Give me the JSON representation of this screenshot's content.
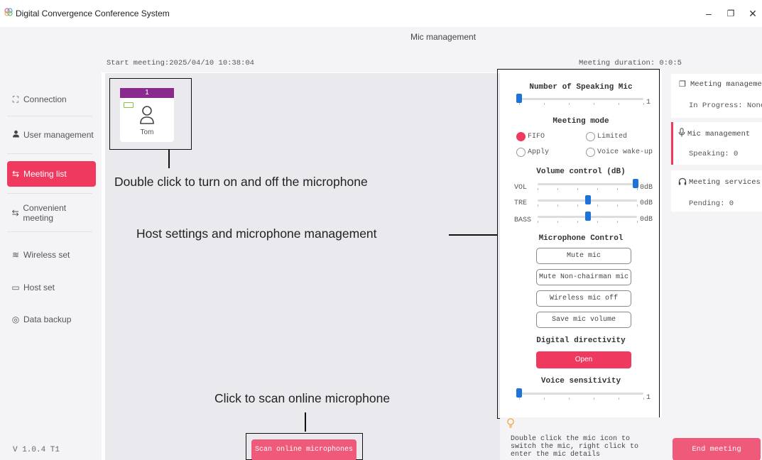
{
  "window": {
    "title": "Digital Convergence Conference System",
    "minimize_label": "–",
    "restore_label": "❐",
    "close_label": "✕"
  },
  "sidebar": {
    "items": [
      {
        "label": "Connection",
        "icon": "connection-icon",
        "glyph": "⛶"
      },
      {
        "label": "User management",
        "icon": "user-icon",
        "glyph": "👤"
      },
      {
        "label": "Meeting list",
        "icon": "swap-icon",
        "glyph": "⇆",
        "active": true
      },
      {
        "label": "Convenient meeting",
        "icon": "swap-icon",
        "glyph": "⇆"
      },
      {
        "label": "Wireless set",
        "icon": "wifi-icon",
        "glyph": "≋"
      },
      {
        "label": "Host set",
        "icon": "host-icon",
        "glyph": "▭"
      },
      {
        "label": "Data backup",
        "icon": "backup-icon",
        "glyph": "◎"
      }
    ],
    "version": "V 1.0.4 T1"
  },
  "main": {
    "title": "Mic management",
    "start_meeting": "Start meeting:2025/04/10 10:38:04",
    "meeting_duration": "Meeting duration: 0:0:5",
    "mic": {
      "number": "1",
      "name": "Tom"
    },
    "scan_button": "Scan online microphones"
  },
  "annotations": {
    "double_click": "Double click to turn on and off the microphone",
    "host_settings": "Host settings and microphone management",
    "scan": "Click to scan online microphone"
  },
  "settings": {
    "speaking_mic_title": "Number of Speaking Mic",
    "speaking_mic_value": "1",
    "speaking_mic_level": 0,
    "meeting_mode_title": "Meeting mode",
    "modes": [
      {
        "label": "FIFO",
        "selected": true
      },
      {
        "label": "Limited",
        "selected": false
      },
      {
        "label": "Apply",
        "selected": false
      },
      {
        "label": "Voice wake-up",
        "selected": false
      }
    ],
    "volume_title": "Volume control (dB)",
    "volumes": [
      {
        "label": "VOL",
        "value": "0dB",
        "level": 1.0
      },
      {
        "label": "TRE",
        "value": "0dB",
        "level": 0.5
      },
      {
        "label": "BASS",
        "value": "0dB",
        "level": 0.5
      }
    ],
    "mic_control_title": "Microphone Control",
    "buttons": [
      "Mute mic",
      "Mute Non-chairman mic",
      "Wireless mic off",
      "Save mic volume"
    ],
    "directivity_title": "Digital directivity",
    "directivity_button": "Open",
    "sensitivity_title": "Voice sensitivity",
    "sensitivity_value": "1",
    "sensitivity_level": 0
  },
  "hint": "Double click the mic icon to switch the mic, right click to enter the mic details",
  "right": {
    "meeting_management": "Meeting managemer",
    "in_progress": "In Progress: None",
    "mic_management": "Mic management",
    "speaking": "Speaking: 0",
    "meeting_services": "Meeting services",
    "pending": "Pending: 0",
    "end_button": "End meeting"
  },
  "colors": {
    "accent": "#f0395f",
    "slider": "#1e73d8",
    "card_header": "#8a2a8f"
  }
}
